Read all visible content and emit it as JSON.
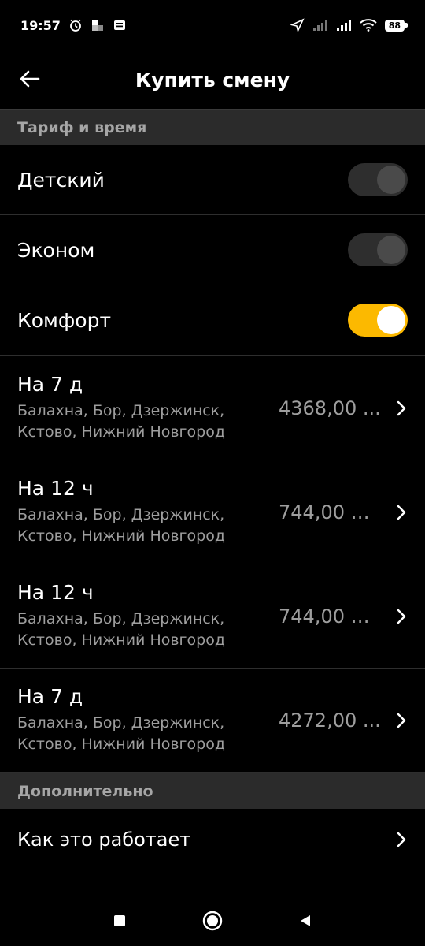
{
  "status_bar": {
    "time": "19:57",
    "battery": "88",
    "icons": [
      "alarm-icon",
      "notification-icon",
      "news-icon",
      "location-icon",
      "signal-icon",
      "signal-icon",
      "wifi-icon",
      "battery-icon"
    ]
  },
  "header": {
    "title": "Купить смену",
    "back_icon": "arrow-left-icon"
  },
  "sections": {
    "tariff_header": "Тариф и время",
    "extra_header": "Дополнительно"
  },
  "tariffs": [
    {
      "label": "Детский",
      "enabled": false
    },
    {
      "label": "Эконом",
      "enabled": false
    },
    {
      "label": "Комфорт",
      "enabled": true
    }
  ],
  "shifts": [
    {
      "title": "На 7 д",
      "cities": "Балахна, Бор, Дзержинск, Кстово, Нижний Новгород",
      "price": "4368,00 ..."
    },
    {
      "title": "На 12 ч",
      "cities": "Балахна, Бор, Дзержинск, Кстово, Нижний Новгород",
      "price": "744,00 R..."
    },
    {
      "title": "На 12 ч",
      "cities": "Балахна, Бор, Дзержинск, Кстово, Нижний Новгород",
      "price": "744,00 R..."
    },
    {
      "title": "На 7 д",
      "cities": "Балахна, Бор, Дзержинск, Кстово, Нижний Новгород",
      "price": "4272,00 ..."
    }
  ],
  "extra": {
    "how_it_works": "Как это работает"
  },
  "colors": {
    "accent": "#fcb900",
    "background": "#000000",
    "section_bg": "#2b2b2b",
    "secondary_text": "#9e9e9e"
  }
}
